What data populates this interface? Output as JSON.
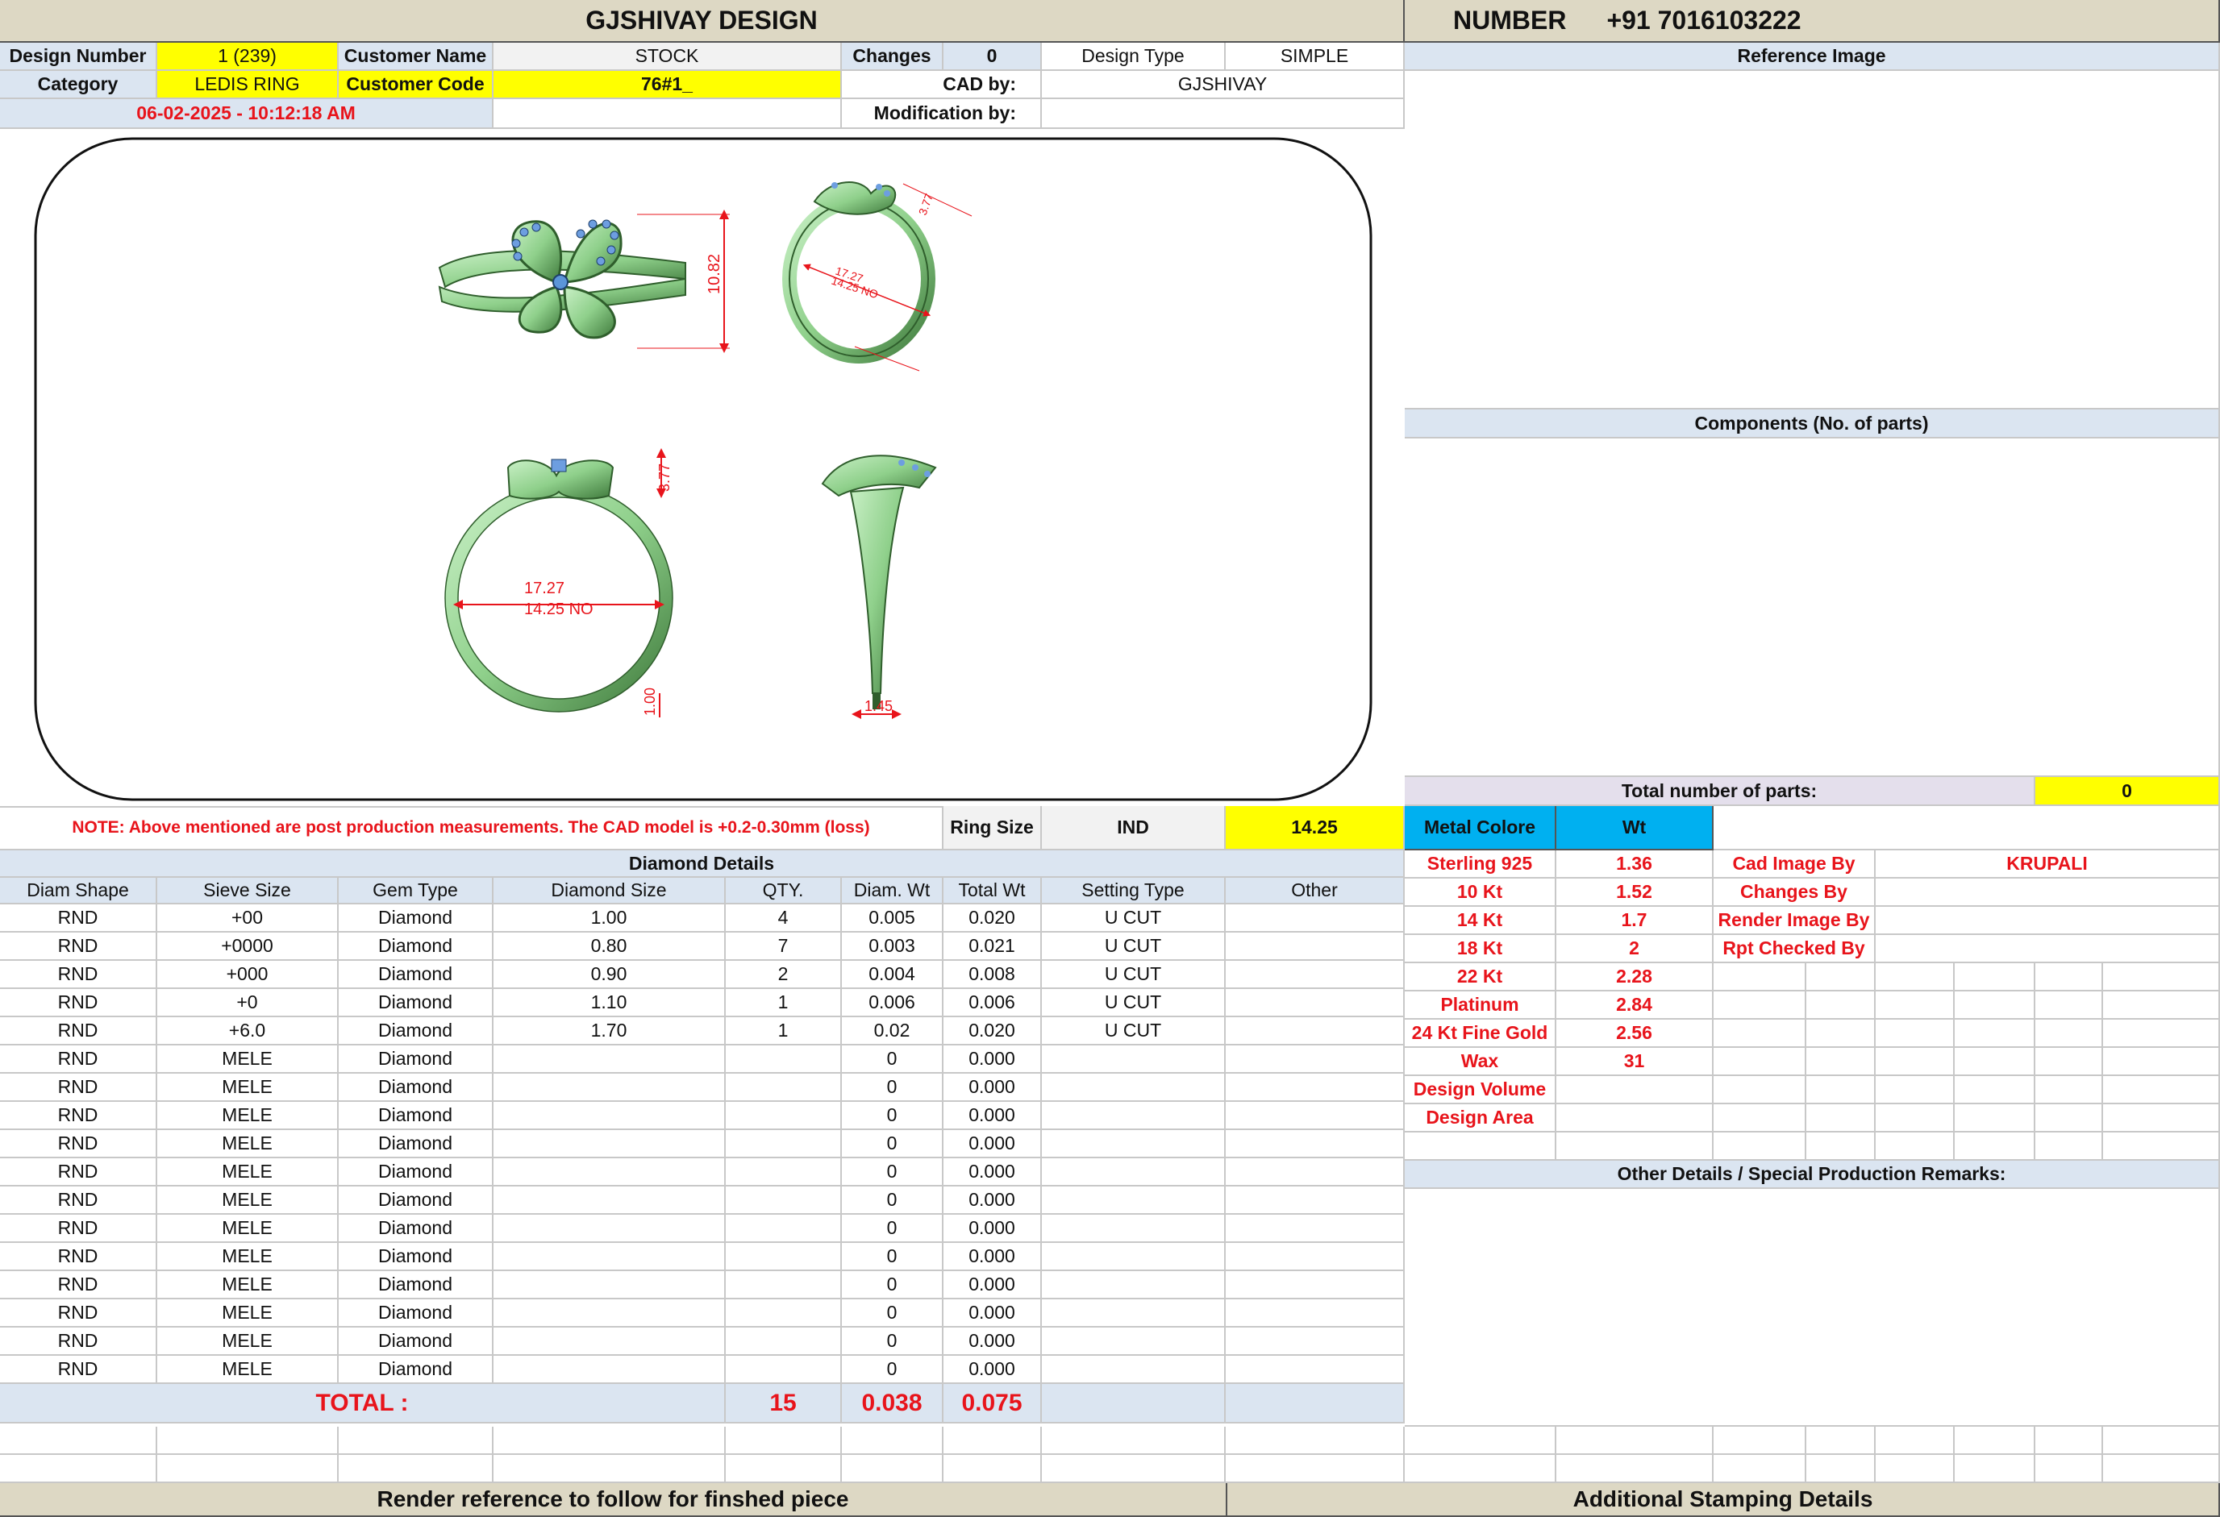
{
  "header": {
    "title": "GJSHIVAY DESIGN",
    "number_label": "NUMBER",
    "number_value": "+91 7016103222"
  },
  "info": {
    "design_number_label": "Design Number",
    "design_number": "1 (239)",
    "customer_name_label": "Customer Name",
    "customer_name": "STOCK",
    "changes_label": "Changes",
    "changes": "0",
    "design_type_label": "Design Type",
    "design_type": "SIMPLE",
    "category_label": "Category",
    "category": "LEDIS RING",
    "customer_code_label": "Customer Code",
    "customer_code": "76#1_",
    "cad_by_label": "CAD by:",
    "cad_by": "GJSHIVAY",
    "datetime": "06-02-2025 - 10:12:18 AM",
    "modification_label": "Modification by:"
  },
  "cad": {
    "dim_height": "10.82",
    "dim_diameter": "17.27",
    "dim_size": "14.25 NO",
    "dim_top": "3.77",
    "dim_band": "1.00",
    "dim_side": "1.45"
  },
  "right": {
    "reference_image": "Reference Image",
    "components": "Components (No. of parts)",
    "total_parts_label": "Total number of parts:",
    "total_parts": "0",
    "metal_colore": "Metal Colore",
    "wt": "Wt",
    "other_details": "Other Details / Special Production Remarks:"
  },
  "note": {
    "text": "NOTE: Above mentioned are post production measurements. The CAD model is +0.2-0.30mm (loss)",
    "ring_size_label": "Ring Size",
    "ring_size_std": "IND",
    "ring_size_value": "14.25"
  },
  "diamond": {
    "title": "Diamond Details",
    "headers": [
      "Diam Shape",
      "Sieve Size",
      "Gem Type",
      "Diamond Size",
      "QTY.",
      "Diam. Wt",
      "Total Wt",
      "Setting Type",
      "Other"
    ],
    "rows": [
      [
        "RND",
        "+00",
        "Diamond",
        "1.00",
        "4",
        "0.005",
        "0.020",
        "U CUT",
        ""
      ],
      [
        "RND",
        "+0000",
        "Diamond",
        "0.80",
        "7",
        "0.003",
        "0.021",
        "U CUT",
        ""
      ],
      [
        "RND",
        "+000",
        "Diamond",
        "0.90",
        "2",
        "0.004",
        "0.008",
        "U CUT",
        ""
      ],
      [
        "RND",
        "+0",
        "Diamond",
        "1.10",
        "1",
        "0.006",
        "0.006",
        "U CUT",
        ""
      ],
      [
        "RND",
        "+6.0",
        "Diamond",
        "1.70",
        "1",
        "0.02",
        "0.020",
        "U CUT",
        ""
      ],
      [
        "RND",
        "MELE",
        "Diamond",
        "",
        "",
        "0",
        "0.000",
        "",
        ""
      ],
      [
        "RND",
        "MELE",
        "Diamond",
        "",
        "",
        "0",
        "0.000",
        "",
        ""
      ],
      [
        "RND",
        "MELE",
        "Diamond",
        "",
        "",
        "0",
        "0.000",
        "",
        ""
      ],
      [
        "RND",
        "MELE",
        "Diamond",
        "",
        "",
        "0",
        "0.000",
        "",
        ""
      ],
      [
        "RND",
        "MELE",
        "Diamond",
        "",
        "",
        "0",
        "0.000",
        "",
        ""
      ],
      [
        "RND",
        "MELE",
        "Diamond",
        "",
        "",
        "0",
        "0.000",
        "",
        ""
      ],
      [
        "RND",
        "MELE",
        "Diamond",
        "",
        "",
        "0",
        "0.000",
        "",
        ""
      ],
      [
        "RND",
        "MELE",
        "Diamond",
        "",
        "",
        "0",
        "0.000",
        "",
        ""
      ],
      [
        "RND",
        "MELE",
        "Diamond",
        "",
        "",
        "0",
        "0.000",
        "",
        ""
      ],
      [
        "RND",
        "MELE",
        "Diamond",
        "",
        "",
        "0",
        "0.000",
        "",
        ""
      ],
      [
        "RND",
        "MELE",
        "Diamond",
        "",
        "",
        "0",
        "0.000",
        "",
        ""
      ],
      [
        "RND",
        "MELE",
        "Diamond",
        "",
        "",
        "0",
        "0.000",
        "",
        ""
      ]
    ],
    "total_label": "TOTAL :",
    "total_qty": "15",
    "total_diam_wt": "0.038",
    "total_wt": "0.075"
  },
  "metals": [
    {
      "name": "Sterling 925",
      "wt": "1.36"
    },
    {
      "name": "10 Kt",
      "wt": "1.52"
    },
    {
      "name": "14 Kt",
      "wt": "1.7"
    },
    {
      "name": "18 Kt",
      "wt": "2"
    },
    {
      "name": "22 Kt",
      "wt": "2.28"
    },
    {
      "name": "Platinum",
      "wt": "2.84"
    },
    {
      "name": "24 Kt Fine Gold",
      "wt": "2.56"
    },
    {
      "name": "Wax",
      "wt": "31"
    },
    {
      "name": "Design Volume",
      "wt": ""
    },
    {
      "name": "Design Area",
      "wt": ""
    }
  ],
  "credits": [
    {
      "label": "Cad Image By",
      "value": "KRUPALI"
    },
    {
      "label": "Changes By",
      "value": ""
    },
    {
      "label": "Render Image By",
      "value": ""
    },
    {
      "label": "Rpt Checked By",
      "value": ""
    }
  ],
  "footer": {
    "render_reference": "Render reference to follow for finshed piece",
    "stamping": "Additional Stamping Details"
  },
  "colors": {
    "header_bg": "#ddd8c4",
    "section_bg": "#dbe5f1",
    "highlight": "#ffff00",
    "metal_header": "#00b0f0",
    "red_text": "#e8141b",
    "ring_green": "#9ed89a"
  }
}
